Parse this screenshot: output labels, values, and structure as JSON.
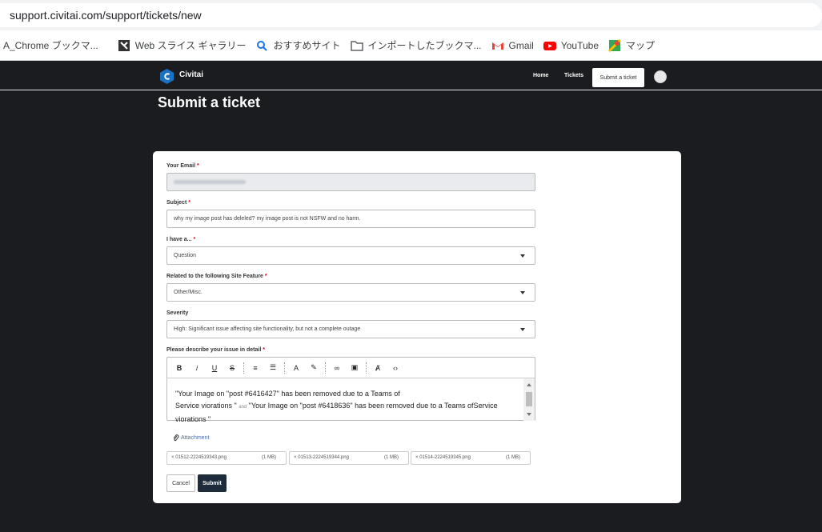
{
  "browser": {
    "url": "support.civitai.com/support/tickets/new",
    "bookmarks": [
      {
        "label": "A_Chrome ブックマ...",
        "icon": "bookmark-icon"
      },
      {
        "label": "Web スライス ギャラリー",
        "icon": "web-slice-icon"
      },
      {
        "label": "おすすめサイト",
        "icon": "search-icon"
      },
      {
        "label": "インポートしたブックマ...",
        "icon": "folder-icon"
      },
      {
        "label": "Gmail",
        "icon": "gmail-icon"
      },
      {
        "label": "YouTube",
        "icon": "youtube-icon"
      },
      {
        "label": "マップ",
        "icon": "maps-icon"
      }
    ]
  },
  "nav": {
    "brand": "Civitai",
    "home": "Home",
    "tickets": "Tickets",
    "submit": "Submit a ticket"
  },
  "page": {
    "title": "Submit a ticket"
  },
  "form": {
    "email_label": "Your Email",
    "subject_label": "Subject",
    "subject_value": "why my image post has deleled? my image post is not NSFW and no harm.",
    "type_label": "I have a...",
    "type_value": "Question",
    "feature_label": "Related to the following Site Feature",
    "feature_value": "Other/Misc.",
    "severity_label": "Severity",
    "severity_value": "High: Significant issue affecting site functionality, but not a complete outage",
    "describe_label": "Please describe your issue in detail",
    "required_mark": "*",
    "description_line1": "\"Your Image on \"post #6416427\" has been removed due to a Teams of",
    "description_line2a": "Service viorations \"",
    "description_and": "and",
    "description_line2b": "\"Your Image on \"post #6418636\" has been removed due to a Teams ofService",
    "description_line3": "viorations \"",
    "attachment": "Attachment",
    "files": [
      {
        "name": "01512-2224519343.png",
        "size": "(1 MB)"
      },
      {
        "name": "01513-2224519344.png",
        "size": "(1 MB)"
      },
      {
        "name": "01514-2224519345.png",
        "size": "(1 MB)"
      }
    ],
    "remove_glyph": "×",
    "cancel": "Cancel",
    "submit": "Submit"
  },
  "colors": {
    "accent": "#1d2b3a",
    "brand": "#1971c2",
    "required": "#d0021b"
  }
}
